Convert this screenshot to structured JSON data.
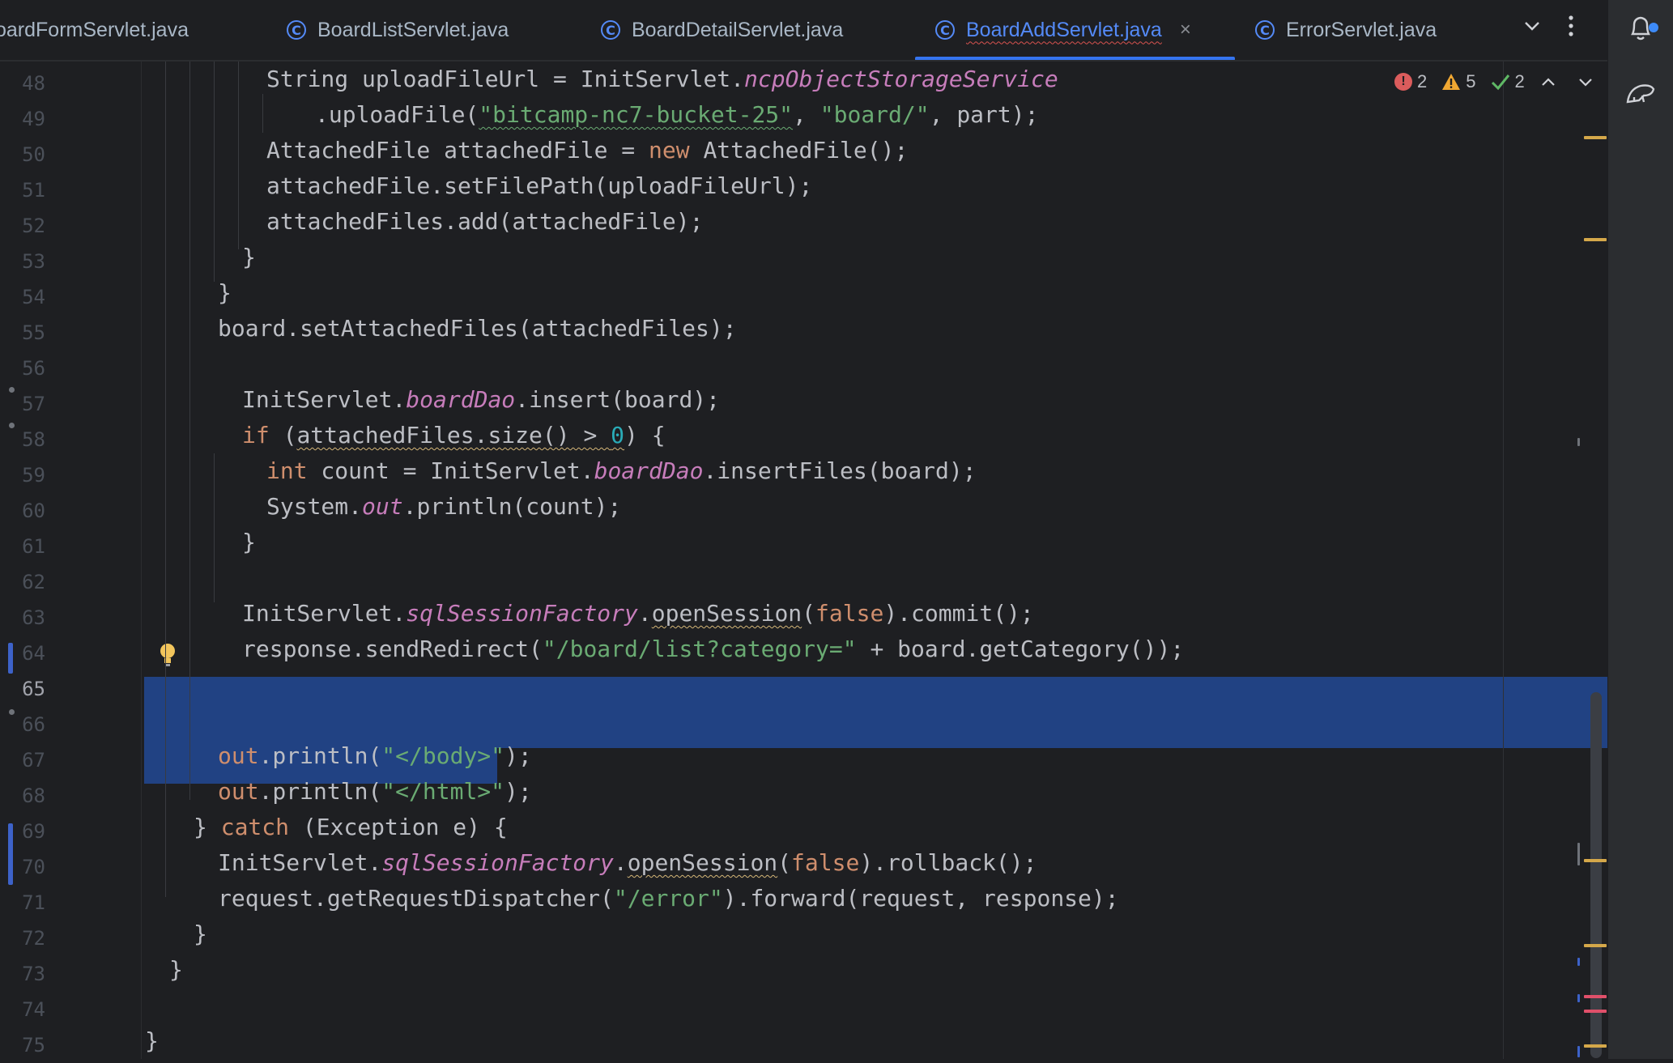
{
  "tabs": [
    {
      "label": "oardFormServlet.java",
      "icon": "class-icon",
      "active": false
    },
    {
      "label": "BoardListServlet.java",
      "icon": "class-icon",
      "active": false
    },
    {
      "label": "BoardDetailServlet.java",
      "icon": "class-icon",
      "active": false
    },
    {
      "label": "BoardAddServlet.java",
      "icon": "class-icon",
      "active": true,
      "close": "×"
    },
    {
      "label": "ErrorServlet.java",
      "icon": "class-icon",
      "active": false
    }
  ],
  "inspections": {
    "errors": "2",
    "warnings": "5",
    "ok": "2"
  },
  "line_numbers": [
    "48",
    "49",
    "50",
    "51",
    "52",
    "53",
    "54",
    "55",
    "56",
    "57",
    "58",
    "59",
    "60",
    "61",
    "62",
    "63",
    "64",
    "65",
    "66",
    "67",
    "68",
    "69",
    "70",
    "71",
    "72",
    "73",
    "74",
    "75"
  ],
  "current_line": "65",
  "code": {
    "l48": {
      "a": "String uploadFileUrl = InitServlet.",
      "b": "ncpObjectStorageService"
    },
    "l49": {
      "a": ".uploadFile(",
      "s1": "\"bitcamp-nc7-bucket-25\"",
      "b": ", ",
      "s2": "\"board/\"",
      "c": ", part);"
    },
    "l50": {
      "a": "AttachedFile attachedFile = ",
      "kw": "new",
      "b": " AttachedFile();"
    },
    "l51": {
      "a": "attachedFile.setFilePath(uploadFileUrl);"
    },
    "l52": {
      "a": "attachedFiles.add(attachedFile);"
    },
    "l53": {
      "a": "}"
    },
    "l54": {
      "a": "}"
    },
    "l55": {
      "a": "board.setAttachedFiles(attachedFiles);"
    },
    "l57": {
      "a": "InitServlet.",
      "it": "boardDao",
      "b": ".insert(board);"
    },
    "l58": {
      "kw": "if",
      "a": " (",
      "w": "attachedFiles.size() > ",
      "num": "0",
      "b": ") {"
    },
    "l59": {
      "kw": "int",
      "a": " count = InitServlet.",
      "it": "boardDao",
      "b": ".insertFiles(board);"
    },
    "l60": {
      "a": "System.",
      "it": "out",
      "b": ".println(count);"
    },
    "l61": {
      "a": "}"
    },
    "l63": {
      "a": "InitServlet.",
      "it": "sqlSessionFactory",
      "b": ".",
      "w": "openSession",
      "c": "(",
      "kw": "false",
      "d": ").commit();"
    },
    "l64": {
      "a": "response.sendRedirect(",
      "s": "\"/board/list?category=\"",
      "b": " + board.getCategory());"
    },
    "l66": {
      "kw": "out",
      "a": ".println(",
      "s": "\"</body>\"",
      "b": ");"
    },
    "l67": {
      "kw": "out",
      "a": ".println(",
      "s": "\"</html>\"",
      "b": ");"
    },
    "l68": {
      "a": "} ",
      "kw": "catch",
      "b": " (Exception e) {"
    },
    "l69": {
      "a": "InitServlet.",
      "it": "sqlSessionFactory",
      "b": ".",
      "w": "openSession",
      "c": "(",
      "kw": "false",
      "d": ").rollback();"
    },
    "l70": {
      "a": "request.getRequestDispatcher(",
      "s": "\"/error\"",
      "b": ").forward(request, response);"
    },
    "l71": {
      "a": "}"
    },
    "l72": {
      "a": "}"
    },
    "l74": {
      "a": "}"
    }
  },
  "icons": {
    "notifications": "bell-icon",
    "assistant": "ai-assistant-icon",
    "more": "more-vertical-icon",
    "tabs_dropdown": "chevron-down-icon",
    "intention": "lightbulb-icon"
  },
  "colors": {
    "keyword": "#cf8e6d",
    "string": "#6aab73",
    "field": "#c77dbb",
    "number": "#2aacb8",
    "selection": "#214283",
    "accent": "#548af7"
  }
}
